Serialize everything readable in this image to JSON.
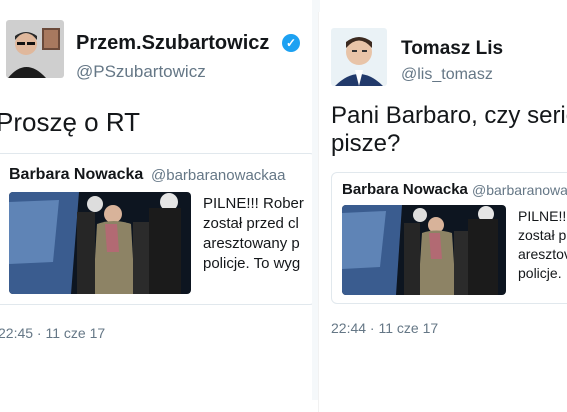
{
  "left_tweet": {
    "author_name": "Przem.Szubartowicz",
    "author_handle": "@PSzubartowicz",
    "verified_icon": "verified-badge-icon",
    "text": "Proszę o RT",
    "quote": {
      "author_name": "Barbara Nowacka",
      "author_handle": "@barbaranowackaa",
      "text_lines": [
        "PILNE!!! Rober",
        "został przed cl",
        "aresztowany p",
        "policje. To wyg"
      ]
    },
    "timestamp": "22:45 · 11 cze 17"
  },
  "right_tweet": {
    "author_name": "Tomasz Lis",
    "author_handle": "@lis_tomasz",
    "text_lines": [
      "Pani Barbaro, czy serio?",
      "pisze?"
    ],
    "quote": {
      "author_name": "Barbara Nowacka",
      "author_handle": "@barbaranowac",
      "text_lines": [
        "PILNE!!!",
        "został p",
        "aresztov",
        "policje."
      ]
    },
    "timestamp": "22:44 · 11 cze 17"
  },
  "colors": {
    "text": "#14171a",
    "secondary": "#657786",
    "verified": "#1da1f2",
    "border": "#e1e8ed"
  }
}
